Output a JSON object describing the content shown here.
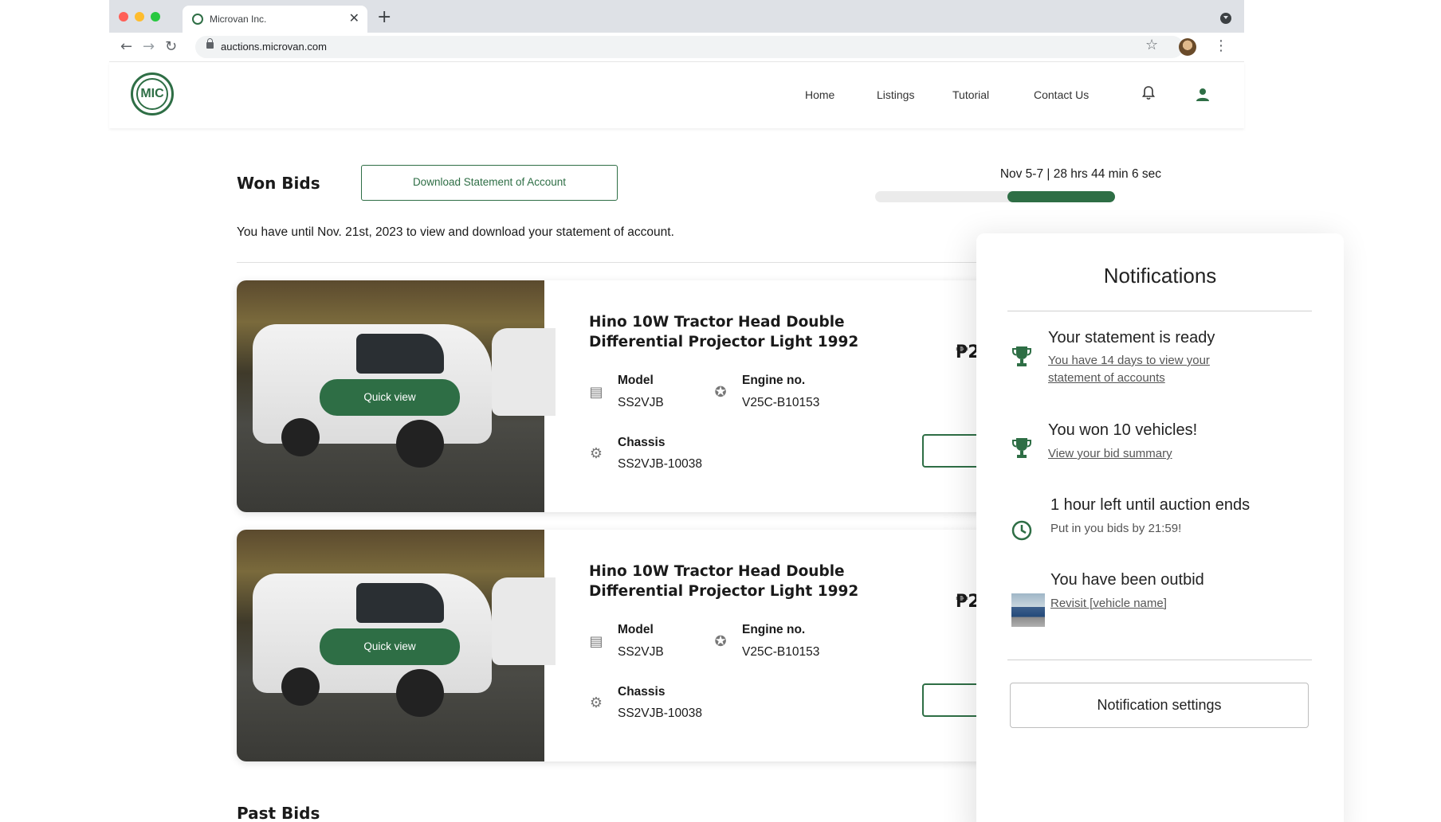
{
  "browser": {
    "tab_title": "Microvan Inc.",
    "url": "auctions.microvan.com",
    "icons": [
      "close-icon",
      "new-tab-icon",
      "back-icon",
      "forward-icon",
      "reload-icon",
      "lock-icon",
      "bookmark-star-icon",
      "profile-avatar",
      "more-options-icon",
      "tab-search-icon"
    ]
  },
  "header": {
    "logo_text": "MIC",
    "nav": [
      "Home",
      "Listings",
      "Tutorial",
      "Contact Us"
    ],
    "icons": [
      "bell-icon",
      "user-icon"
    ]
  },
  "won_bids": {
    "title": "Won Bids",
    "download_label": "Download Statement of Account",
    "timer_text": "Nov 5-7 | 28 hrs 44 min 6 sec",
    "progress_fraction": 0.45,
    "notice": "You have until Nov. 21st, 2023 to view and download your statement of account."
  },
  "cards": [
    {
      "quick_view": "Quick view",
      "title": "Hino 10W Tractor Head Double Differential Projector Light 1992",
      "price_prefix": "₱2",
      "model_label": "Model",
      "model_value": "SS2VJB",
      "engine_label": "Engine no.",
      "engine_value": "V25C-B10153",
      "chassis_label": "Chassis",
      "chassis_value": "SS2VJB-10038"
    },
    {
      "quick_view": "Quick view",
      "title": "Hino 10W Tractor Head Double Differential Projector Light 1992",
      "price_prefix": "₱2",
      "model_label": "Model",
      "model_value": "SS2VJB",
      "engine_label": "Engine no.",
      "engine_value": "V25C-B10153",
      "chassis_label": "Chassis",
      "chassis_value": "SS2VJB-10038"
    }
  ],
  "past_bids": {
    "title": "Past Bids"
  },
  "notifications": {
    "title": "Notifications",
    "items": [
      {
        "icon": "trophy-icon",
        "title": "Your statement is ready",
        "link_line1": "You have 14 days to view your",
        "link_line2": "statement of accounts"
      },
      {
        "icon": "trophy-icon",
        "title": "You won 10 vehicles!",
        "link": "View your bid summary"
      },
      {
        "icon": "clock-icon",
        "title": "1 hour left until auction ends",
        "sub": "Put in you bids by 21:59!"
      },
      {
        "icon": "vehicle-thumbnail",
        "title": "You have been outbid",
        "link": "Revisit [vehicle name]"
      }
    ],
    "settings_label": "Notification settings"
  },
  "colors": {
    "accent": "#2e6e45",
    "tabbar": "#dee1e6"
  }
}
